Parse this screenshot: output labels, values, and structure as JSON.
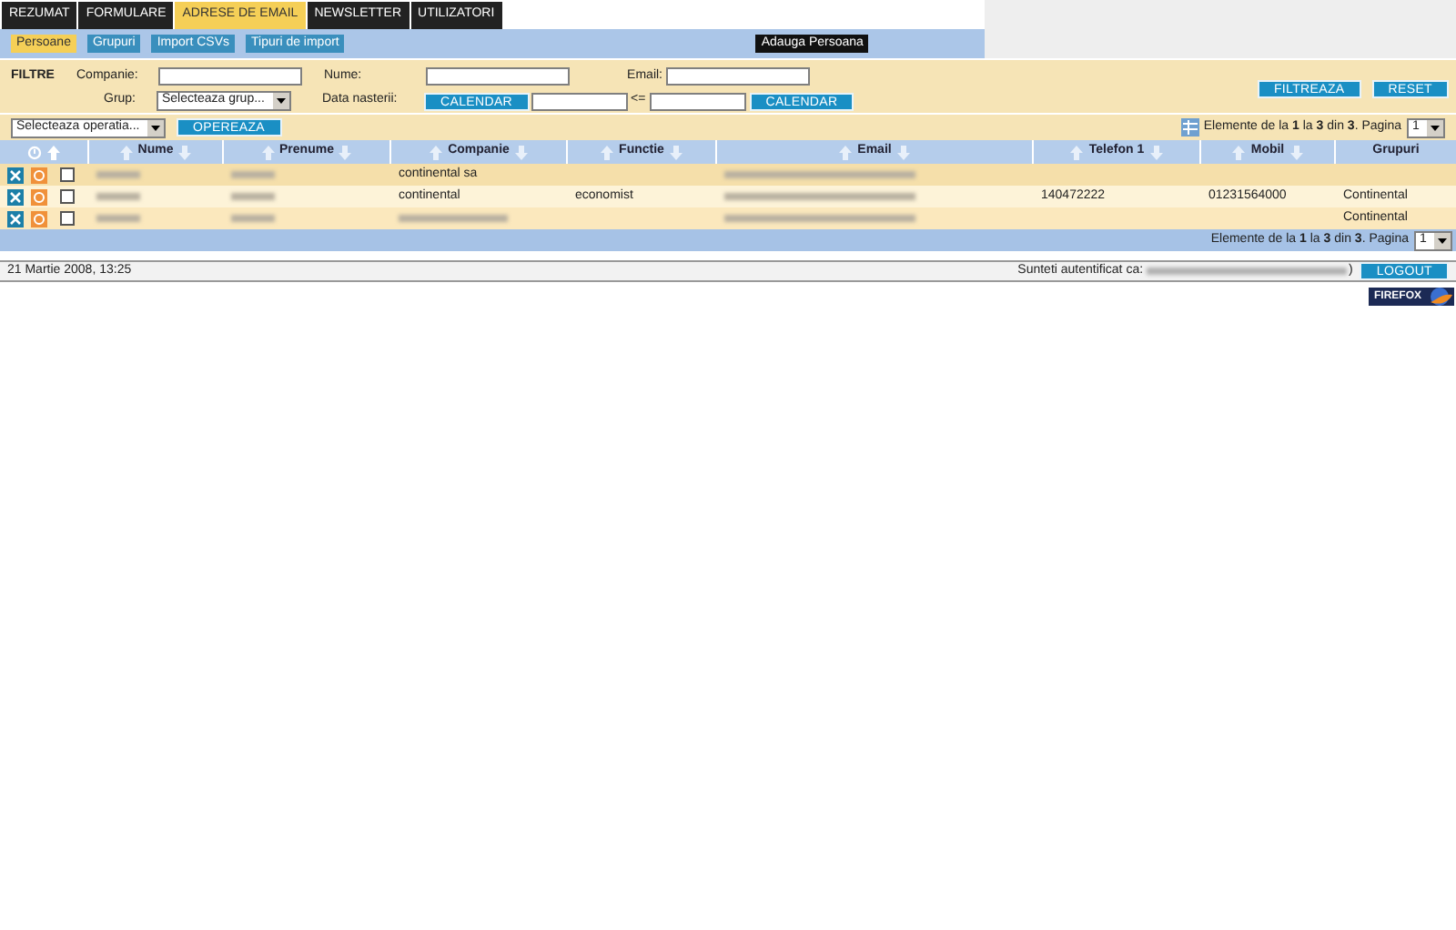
{
  "tabs": [
    {
      "label": "REZUMAT",
      "selected": false
    },
    {
      "label": "FORMULARE",
      "selected": false
    },
    {
      "label": "ADRESE DE EMAIL",
      "selected": true
    },
    {
      "label": "NEWSLETTER",
      "selected": false
    },
    {
      "label": "UTILIZATORI",
      "selected": false
    }
  ],
  "subnav": [
    {
      "label": "Persoane",
      "selected": true
    },
    {
      "label": "Grupuri",
      "selected": false
    },
    {
      "label": "Import CSVs",
      "selected": false
    },
    {
      "label": "Tipuri de import",
      "selected": false
    }
  ],
  "add_button": "Adauga Persoana",
  "filters": {
    "title": "FILTRE",
    "company_label": "Companie:",
    "name_label": "Nume:",
    "email_label": "Email:",
    "group_label": "Grup:",
    "group_select": "Selecteaza grup...",
    "birth_label": "Data nasterii:",
    "calendar_buttons": [
      "CALENDAR",
      "CALENDAR"
    ],
    "range_sep": "<=",
    "filter_button": "FILTREAZA",
    "reset_button": "RESET"
  },
  "operations": {
    "select": "Selecteaza operatia...",
    "button": "OPEREAZA"
  },
  "pagination_top": {
    "text": "Elemente de la **1** la **3** din **3**. Pagina",
    "page": "1"
  },
  "table": {
    "columns": [
      {
        "label": "Nume",
        "sortable": true
      },
      {
        "label": "Prenume",
        "sortable": true
      },
      {
        "label": "Companie",
        "sortable": true
      },
      {
        "label": "Functie",
        "sortable": true
      },
      {
        "label": "Email",
        "sortable": true
      },
      {
        "label": "Telefon 1",
        "sortable": true
      },
      {
        "label": "Mobil",
        "sortable": true
      },
      {
        "label": "Grupuri",
        "sortable": false
      }
    ],
    "rows": [
      {
        "checked": false,
        "cells": [
          {
            "kind": "redacted"
          },
          {
            "kind": "redacted"
          },
          {
            "kind": "text",
            "text": "continental sa"
          },
          {
            "kind": "empty"
          },
          {
            "kind": "redacted"
          },
          {
            "kind": "empty"
          },
          {
            "kind": "empty"
          },
          {
            "kind": "empty"
          }
        ]
      },
      {
        "checked": false,
        "cells": [
          {
            "kind": "redacted"
          },
          {
            "kind": "redacted"
          },
          {
            "kind": "text",
            "text": "continental"
          },
          {
            "kind": "text",
            "text": "economist"
          },
          {
            "kind": "redacted"
          },
          {
            "kind": "text",
            "text": "140472222"
          },
          {
            "kind": "text",
            "text": "01231564000"
          },
          {
            "kind": "text",
            "text": "Continental"
          }
        ]
      },
      {
        "checked": false,
        "cells": [
          {
            "kind": "redacted"
          },
          {
            "kind": "redacted"
          },
          {
            "kind": "redacted"
          },
          {
            "kind": "empty"
          },
          {
            "kind": "redacted"
          },
          {
            "kind": "empty"
          },
          {
            "kind": "empty"
          },
          {
            "kind": "text",
            "text": "Continental"
          }
        ]
      }
    ]
  },
  "pagination_bottom": {
    "text": "Elemente de la **1** la **3** din **3**. Pagina",
    "page": "1"
  },
  "status": {
    "date": "21 Martie 2008, 13:25",
    "auth_label": "Sunteti autentificat ca:",
    "auth_suffix": ")",
    "logout": "LOGOUT"
  },
  "badge": "FIREFOX"
}
